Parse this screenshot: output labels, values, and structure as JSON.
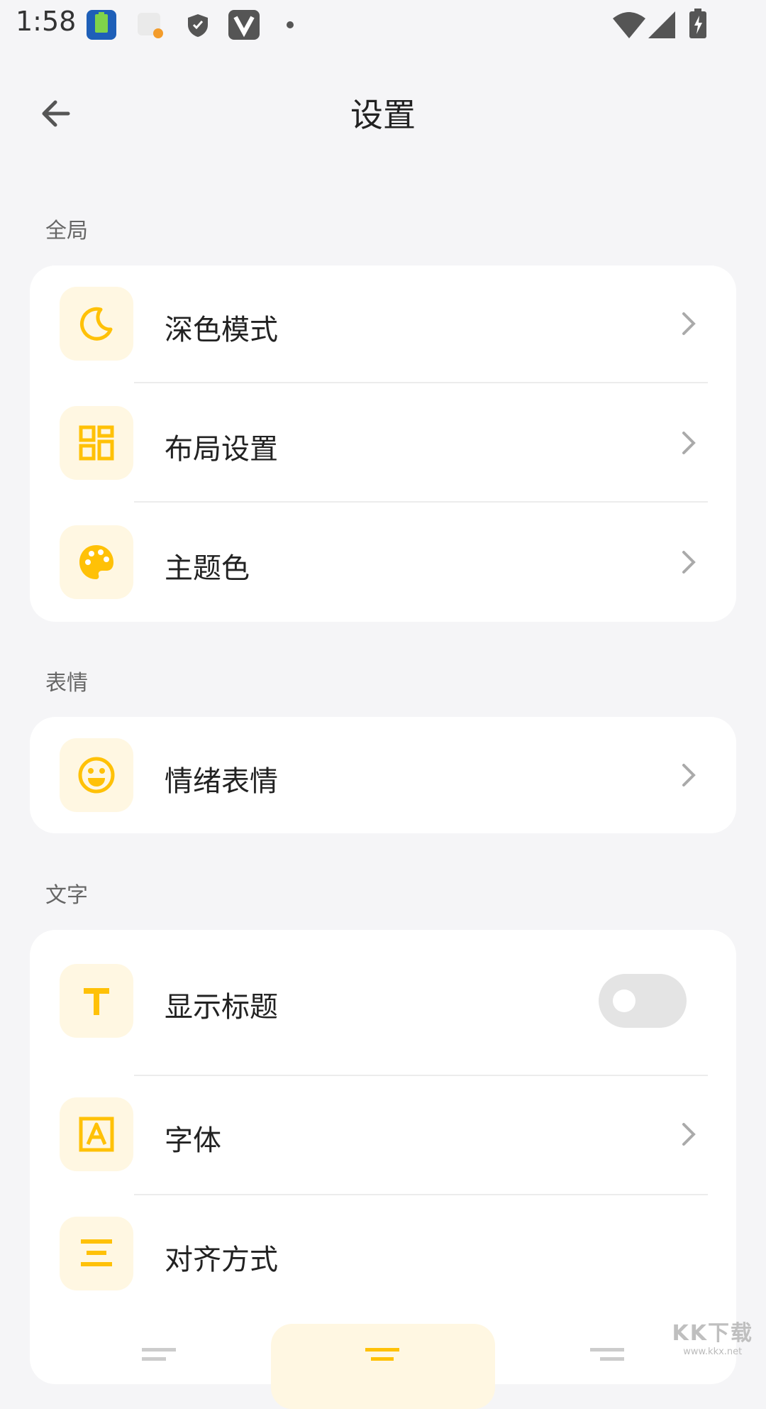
{
  "status_bar": {
    "time": "1:58",
    "icons": [
      "battery-app-icon",
      "notification-app-icon",
      "shield-icon",
      "v-app-icon",
      "dot-icon",
      "wifi-icon",
      "cell-signal-icon",
      "battery-charging-icon"
    ]
  },
  "app_bar": {
    "back_icon": "arrow-left-icon",
    "title": "设置"
  },
  "colors": {
    "accent": "#ffc107",
    "icon_bg": "#fff7e2",
    "background": "#f5f5f7",
    "card": "#ffffff",
    "toggle_off": "#e4e4e4"
  },
  "sections": [
    {
      "label": "全局",
      "items": [
        {
          "label": "深色模式",
          "icon": "moon-icon",
          "control": "chevron"
        },
        {
          "label": "布局设置",
          "icon": "layout-grid-icon",
          "control": "chevron"
        },
        {
          "label": "主题色",
          "icon": "palette-icon",
          "control": "chevron"
        }
      ]
    },
    {
      "label": "表情",
      "items": [
        {
          "label": "情绪表情",
          "icon": "smiley-icon",
          "control": "chevron"
        }
      ]
    },
    {
      "label": "文字",
      "items": [
        {
          "label": "显示标题",
          "icon": "text-t-icon",
          "control": "toggle",
          "toggle_on": false
        },
        {
          "label": "字体",
          "icon": "font-a-icon",
          "control": "chevron"
        },
        {
          "label": "对齐方式",
          "icon": "align-center-icon",
          "control": "align-options"
        }
      ]
    }
  ],
  "alignment": {
    "options": [
      "align-left-icon",
      "align-center-icon",
      "align-right-icon"
    ],
    "selected": "align-center-icon"
  },
  "watermark": {
    "main": "KK下载",
    "sub": "www.kkx.net"
  }
}
